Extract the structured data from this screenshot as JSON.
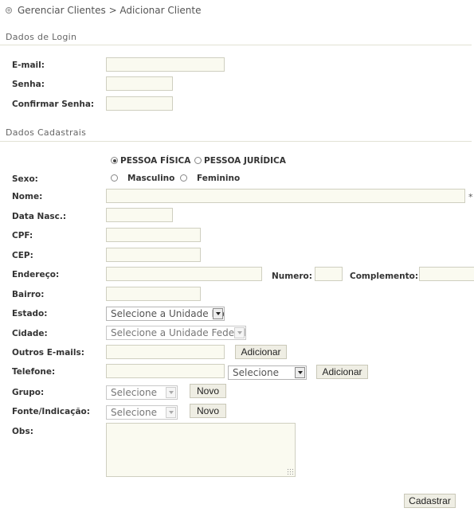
{
  "breadcrumb": {
    "icon": "plus-circle-icon",
    "text": "Gerenciar Clientes > Adicionar Cliente"
  },
  "login": {
    "title": "Dados de Login",
    "email_label": "E-mail:",
    "senha_label": "Senha:",
    "confirmar_label": "Confirmar Senha:"
  },
  "cadastrais": {
    "title": "Dados Cadastrais",
    "pessoa_fisica": "PESSOA FÍSICA",
    "pessoa_juridica": "PESSOA JURÍDICA",
    "sexo_label": "Sexo:",
    "masculino": "Masculino",
    "feminino": "Feminino",
    "nome_label": "Nome:",
    "required_mark": "*",
    "data_label": "Data Nasc.:",
    "cpf_label": "CPF:",
    "cep_label": "CEP:",
    "endereco_label": "Endereço:",
    "numero_label": "Numero:",
    "complemento_label": "Complemento:",
    "bairro_label": "Bairro:",
    "estado_label": "Estado:",
    "estado_value": "Selecione a Unidade Federal",
    "cidade_label": "Cidade:",
    "cidade_value": "Selecione a Unidade Federal",
    "emails_label": "Outros E-mails:",
    "adicionar_label": "Adicionar",
    "telefone_label": "Telefone:",
    "telefone_type_value": "Selecione",
    "grupo_label": "Grupo:",
    "grupo_value": "Selecione",
    "novo_label": "Novo",
    "fonte_label": "Fonte/Indicação:",
    "fonte_value": "Selecione",
    "obs_label": "Obs:"
  },
  "submit_label": "Cadastrar"
}
